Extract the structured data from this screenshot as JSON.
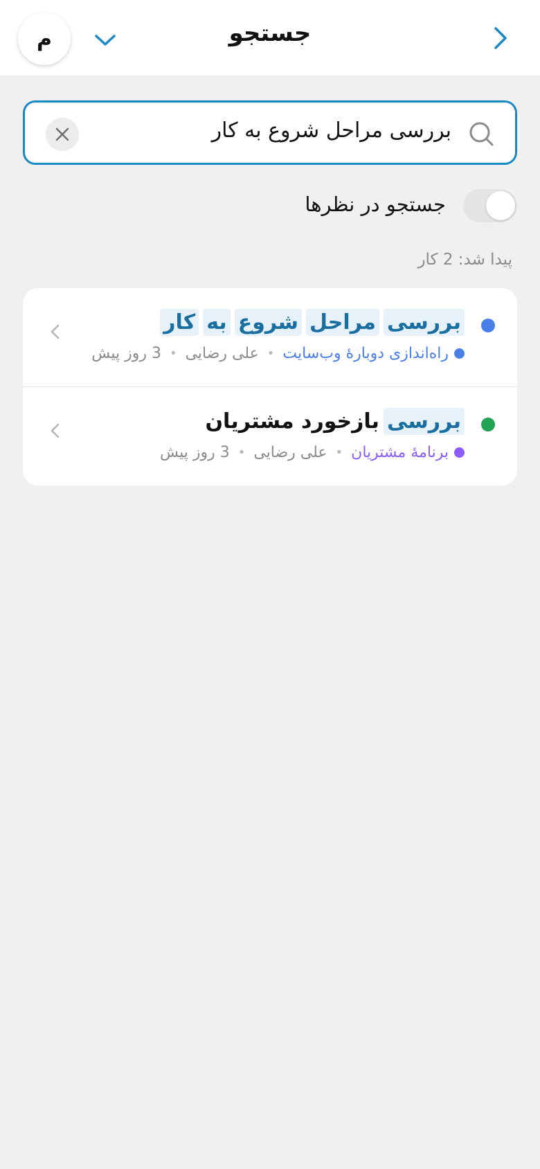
{
  "header": {
    "title": "جستجو",
    "avatar_letter": "م"
  },
  "search": {
    "value": "بررسی مراحل شروع به کار"
  },
  "toggle": {
    "label": "جستجو در نظرها",
    "on": false
  },
  "result_count": "پیدا شد: 2 کار",
  "results": [
    {
      "title_words": [
        "بررسی",
        "مراحل",
        "شروع",
        "به",
        "کار"
      ],
      "status_color": "#4a7fe8",
      "project": "راه‌اندازی دوبارهٔ وب‌سایت",
      "project_color": "#4a7fe8",
      "assignee": "علی رضایی",
      "time": "3 روز پیش"
    },
    {
      "title_highlight": "بررسی",
      "title_rest": "بازخورد مشتریان",
      "status_color": "#22a454",
      "project": "برنامهٔ مشتریان",
      "project_color": "#8b5cf6",
      "assignee": "علی رضایی",
      "time": "3 روز پیش"
    }
  ],
  "colors": {
    "accent": "#1a88c4",
    "highlight_bg": "#e6f1f9",
    "highlight_text": "#1a6fa0"
  },
  "icons": {
    "back": "chevron-right-icon",
    "dropdown": "chevron-down-icon",
    "search": "search-icon",
    "clear": "close-icon",
    "row_chevron": "chevron-left-icon"
  }
}
